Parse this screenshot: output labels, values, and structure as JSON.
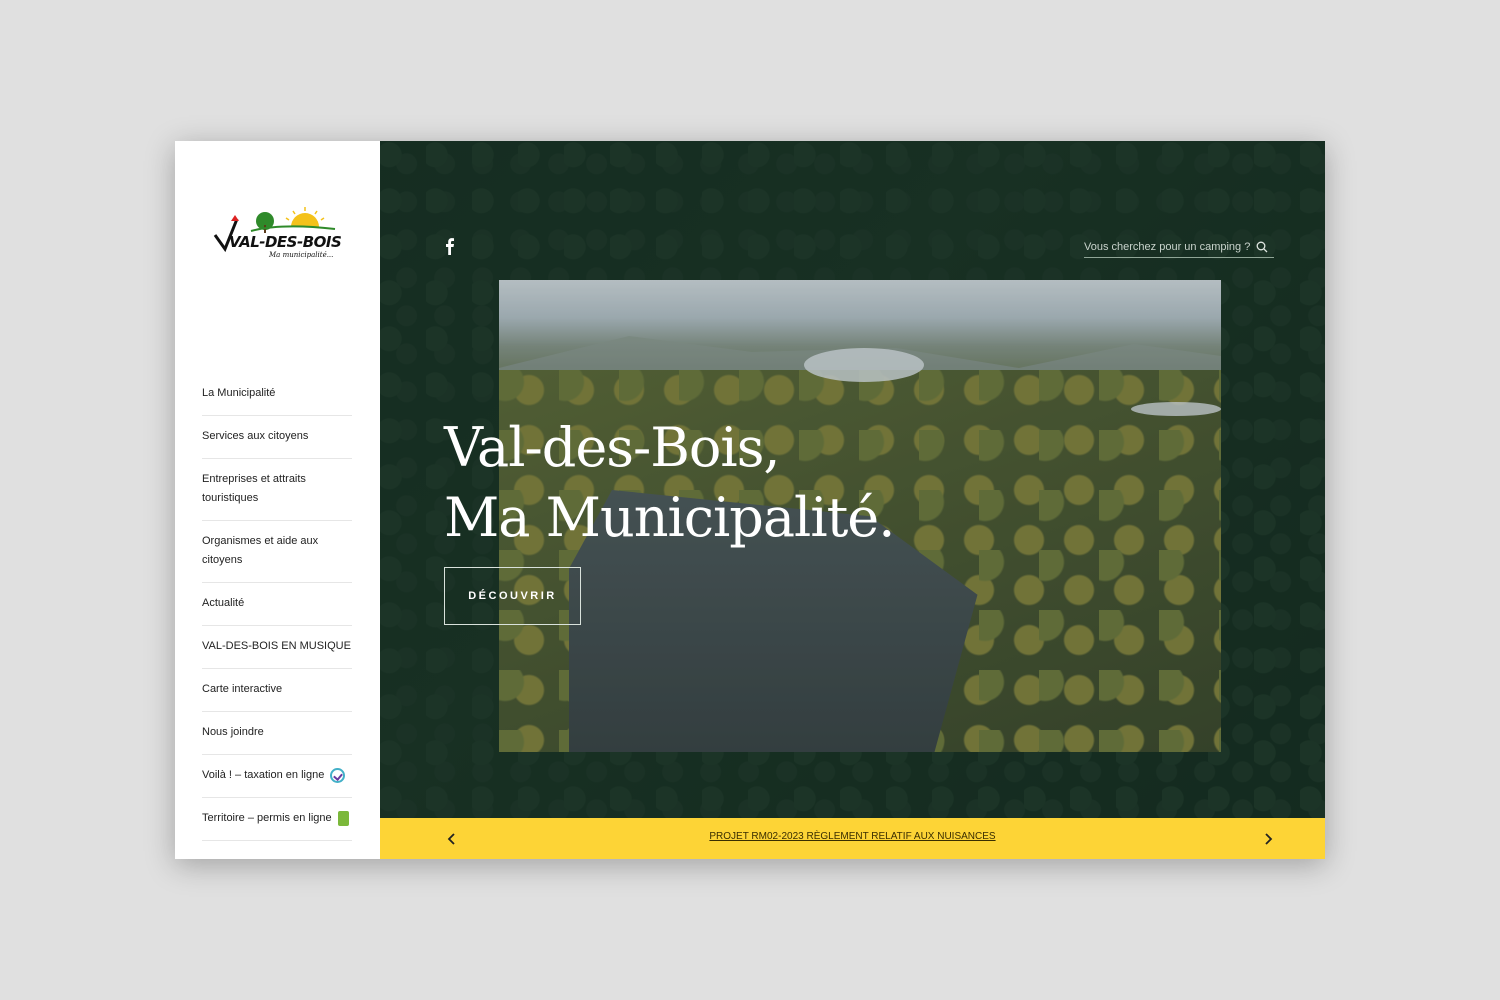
{
  "brand": {
    "logo_text": "VAL-DES-BOIS",
    "logo_tagline": "Ma municipalité..."
  },
  "sidebar": {
    "items": [
      {
        "label": "La Municipalité"
      },
      {
        "label": "Services aux citoyens"
      },
      {
        "label": "Entreprises et attraits touristiques"
      },
      {
        "label": "Organismes et aide aux citoyens"
      },
      {
        "label": "Actualité"
      },
      {
        "label": "VAL-DES-BOIS EN MUSIQUE"
      },
      {
        "label": "Carte interactive"
      },
      {
        "label": "Nous joindre"
      },
      {
        "label": "Voilà ! – taxation en ligne",
        "icon": "voila-badge-icon"
      },
      {
        "label": "Territoire – permis en ligne",
        "icon": "document-icon"
      }
    ]
  },
  "header": {
    "social_icon": "facebook-icon",
    "search_placeholder": "Vous cherchez pour un camping ?"
  },
  "hero": {
    "title_line1": "Val-des-Bois,",
    "title_line2": "Ma Municipalité.",
    "cta_label": "DÉCOUVRIR"
  },
  "banner": {
    "text": "PROJET RM02-2023 RÈGLEMENT RELATIF AUX NUISANCES"
  },
  "colors": {
    "accent_yellow": "#fdd436",
    "forest_green": "#1e3a2c"
  }
}
